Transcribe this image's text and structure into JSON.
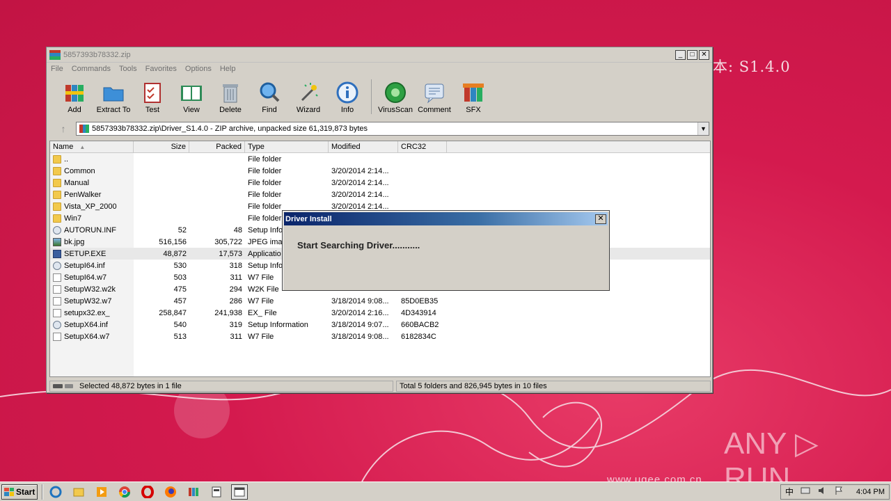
{
  "window": {
    "title": "5857393b78332.zip",
    "menu": [
      "File",
      "Commands",
      "Tools",
      "Favorites",
      "Options",
      "Help"
    ],
    "minimize": "_",
    "maximize": "□",
    "close": "✕"
  },
  "toolbar": {
    "buttons": [
      {
        "label": "Add",
        "icon": "add-archive-icon"
      },
      {
        "label": "Extract To",
        "icon": "extract-folder-icon"
      },
      {
        "label": "Test",
        "icon": "test-clipboard-icon"
      },
      {
        "label": "View",
        "icon": "view-book-icon"
      },
      {
        "label": "Delete",
        "icon": "trash-icon"
      },
      {
        "label": "Find",
        "icon": "magnifier-icon"
      },
      {
        "label": "Wizard",
        "icon": "wand-icon"
      },
      {
        "label": "Info",
        "icon": "info-icon"
      },
      {
        "label": "VirusScan",
        "icon": "virus-scan-icon"
      },
      {
        "label": "Comment",
        "icon": "comment-icon"
      },
      {
        "label": "SFX",
        "icon": "sfx-icon"
      }
    ]
  },
  "address": {
    "path": "5857393b78332.zip\\Driver_S1.4.0 - ZIP archive, unpacked size 61,319,873 bytes"
  },
  "list": {
    "columns": [
      "Name",
      "Size",
      "Packed",
      "Type",
      "Modified",
      "CRC32"
    ],
    "sort_indicator": "▲",
    "rows": [
      {
        "name": "..",
        "size": "",
        "packed": "",
        "type": "File folder",
        "modified": "",
        "crc": "",
        "icon": "folder"
      },
      {
        "name": "Common",
        "size": "",
        "packed": "",
        "type": "File folder",
        "modified": "3/20/2014 2:14...",
        "crc": "",
        "icon": "folder"
      },
      {
        "name": "Manual",
        "size": "",
        "packed": "",
        "type": "File folder",
        "modified": "3/20/2014 2:14...",
        "crc": "",
        "icon": "folder"
      },
      {
        "name": "PenWalker",
        "size": "",
        "packed": "",
        "type": "File folder",
        "modified": "3/20/2014 2:14...",
        "crc": "",
        "icon": "folder"
      },
      {
        "name": "Vista_XP_2000",
        "size": "",
        "packed": "",
        "type": "File folder",
        "modified": "3/20/2014 2:14...",
        "crc": "",
        "icon": "folder"
      },
      {
        "name": "Win7",
        "size": "",
        "packed": "",
        "type": "File folder",
        "modified": "",
        "crc": "",
        "icon": "folder"
      },
      {
        "name": "AUTORUN.INF",
        "size": "52",
        "packed": "48",
        "type": "Setup Info",
        "modified": "",
        "crc": "",
        "icon": "cfg"
      },
      {
        "name": "bk.jpg",
        "size": "516,156",
        "packed": "305,722",
        "type": "JPEG imag",
        "modified": "",
        "crc": "",
        "icon": "img"
      },
      {
        "name": "SETUP.EXE",
        "size": "48,872",
        "packed": "17,573",
        "type": "Applicatio",
        "modified": "",
        "crc": "",
        "icon": "exe"
      },
      {
        "name": "SetupI64.inf",
        "size": "530",
        "packed": "318",
        "type": "Setup Info",
        "modified": "",
        "crc": "",
        "icon": "cfg"
      },
      {
        "name": "SetupI64.w7",
        "size": "503",
        "packed": "311",
        "type": "W7 File",
        "modified": "",
        "crc": "",
        "icon": "file"
      },
      {
        "name": "SetupW32.w2k",
        "size": "475",
        "packed": "294",
        "type": "W2K File",
        "modified": "",
        "crc": "",
        "icon": "file"
      },
      {
        "name": "SetupW32.w7",
        "size": "457",
        "packed": "286",
        "type": "W7 File",
        "modified": "3/18/2014 9:08...",
        "crc": "85D0EB35",
        "icon": "file"
      },
      {
        "name": "setupx32.ex_",
        "size": "258,847",
        "packed": "241,938",
        "type": "EX_ File",
        "modified": "3/20/2014 2:16...",
        "crc": "4D343914",
        "icon": "file"
      },
      {
        "name": "SetupX64.inf",
        "size": "540",
        "packed": "319",
        "type": "Setup Information",
        "modified": "3/18/2014 9:07...",
        "crc": "660BACB2",
        "icon": "cfg"
      },
      {
        "name": "SetupX64.w7",
        "size": "513",
        "packed": "311",
        "type": "W7 File",
        "modified": "3/18/2014 9:08...",
        "crc": "6182834C",
        "icon": "file"
      }
    ],
    "selected_index": 8
  },
  "status": {
    "left": "Selected 48,872 bytes in 1 file",
    "right": "Total 5 folders and 826,945 bytes in 10 files"
  },
  "dialog": {
    "title": "Driver Install",
    "close": "✕",
    "message": "Start Searching Driver..........."
  },
  "desktop": {
    "version_text": "本: S1.4.0",
    "url_text": "www.ugee.com.cn",
    "logo_text": "ANY ▷ RUN"
  },
  "taskbar": {
    "start_label": "Start",
    "clock": "4:04 PM",
    "apps": [
      "ie-icon",
      "explorer-icon",
      "media-player-icon",
      "chrome-icon",
      "opera-icon",
      "firefox-icon",
      "winrar-icon",
      "installer-icon",
      "driver-install-icon"
    ]
  },
  "colors": {
    "wallpaper": "#d5174f",
    "dialog_title": "#0a246a"
  }
}
